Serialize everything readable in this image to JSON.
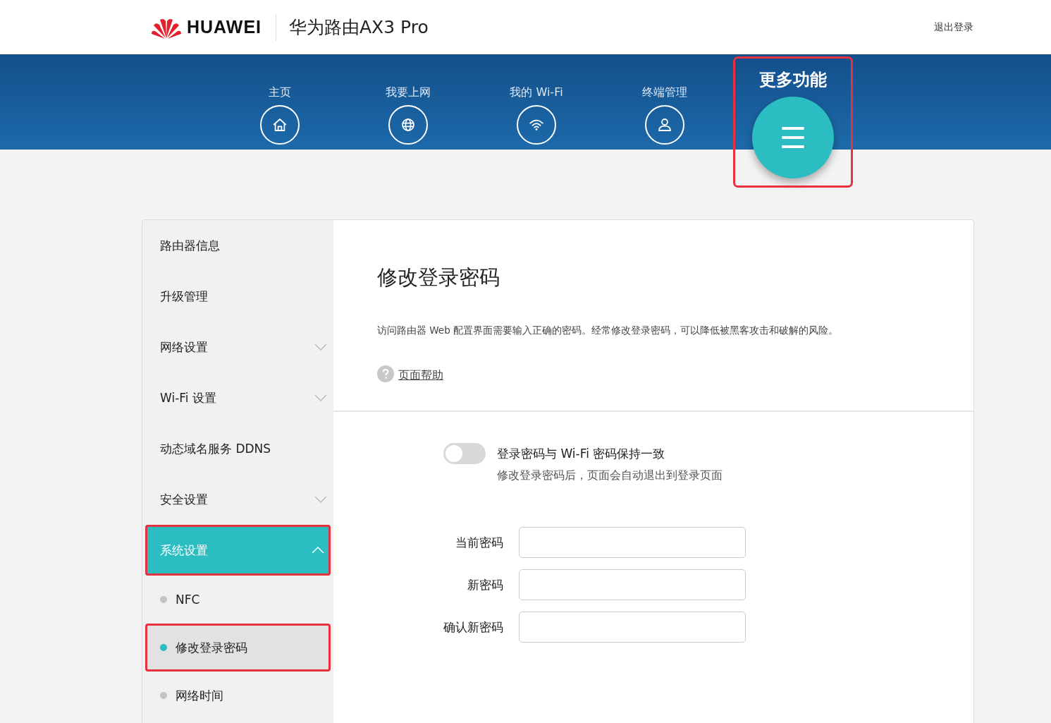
{
  "header": {
    "brand": "HUAWEI",
    "product": "华为路由AX3 Pro",
    "logout": "退出登录"
  },
  "nav": [
    {
      "label": "主页",
      "kind": "regular",
      "annotated": false
    },
    {
      "label": "我要上网",
      "kind": "regular",
      "annotated": false
    },
    {
      "label": "我的 Wi-Fi",
      "kind": "regular",
      "annotated": false
    },
    {
      "label": "终端管理",
      "kind": "regular",
      "annotated": false
    },
    {
      "label": "更多功能",
      "kind": "featured",
      "annotated": true
    }
  ],
  "sidebar": {
    "items": [
      {
        "label": "路由器信息",
        "selected": false,
        "annotated": false
      },
      {
        "label": "升级管理",
        "selected": false,
        "annotated": false
      },
      {
        "label": "网络设置",
        "selected": false,
        "annotated": false,
        "expanded": false
      },
      {
        "label": "Wi-Fi 设置",
        "selected": false,
        "annotated": false,
        "expanded": false
      },
      {
        "label": "动态域名服务 DDNS",
        "selected": false,
        "annotated": false
      },
      {
        "label": "安全设置",
        "selected": false,
        "annotated": false,
        "expanded": false
      },
      {
        "label": "系统设置",
        "selected": true,
        "annotated": true,
        "expanded": true,
        "children": [
          {
            "label": "NFC",
            "selected": false,
            "annotated": false
          },
          {
            "label": "修改登录密码",
            "selected": true,
            "annotated": true
          },
          {
            "label": "网络时间",
            "selected": false,
            "annotated": false
          }
        ]
      }
    ]
  },
  "content": {
    "title": "修改登录密码",
    "description": "访问路由器 Web 配置界面需要输入正确的密码。经常修改登录密码，可以降低被黑客攻击和破解的风险。",
    "help_link": "页面帮助",
    "sync_toggle": {
      "label": "登录密码与 Wi-Fi 密码保持一致",
      "note": "修改登录密码后，页面会自动退出到登录页面",
      "on": false
    },
    "fields": [
      {
        "label": "当前密码"
      },
      {
        "label": "新密码"
      },
      {
        "label": "确认新密码"
      }
    ]
  }
}
